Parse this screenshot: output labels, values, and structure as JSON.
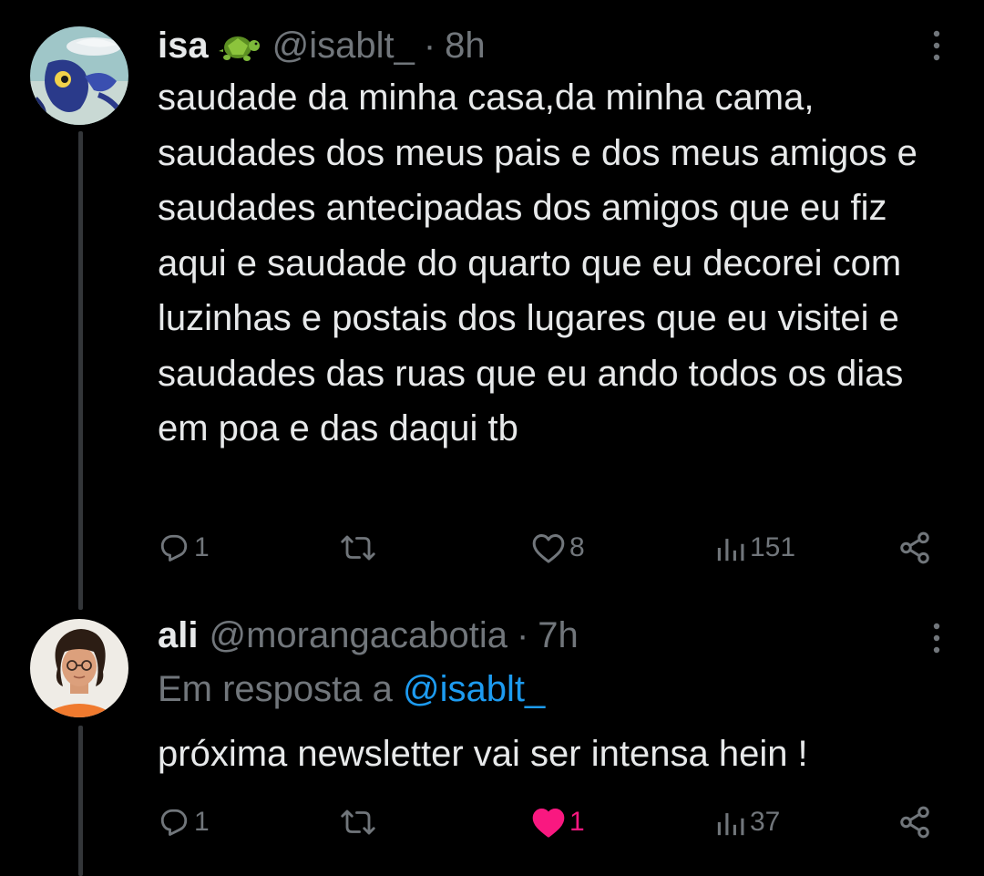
{
  "tweets": [
    {
      "name": "isa",
      "emoji": "turtle-emoji",
      "handle": "@isablt_",
      "separator": "·",
      "time": "8h",
      "text": "saudade da minha casa,da minha cama, saudades dos meus pais e dos meus amigos e saudades antecipadas dos amigos que eu fiz aqui e saudade do quarto que eu decorei com luzinhas e postais dos lugares que eu visitei e saudades das ruas que eu ando todos os dias em poa e das daqui tb",
      "actions": {
        "replies": "1",
        "retweets": "",
        "likes": "8",
        "views": "151"
      },
      "liked": false
    },
    {
      "name": "ali",
      "handle": "@morangacabotia",
      "separator": "·",
      "time": "7h",
      "reply_prefix": "Em resposta a",
      "reply_mention": "@isablt_",
      "text": "próxima newsletter vai ser intensa hein !",
      "actions": {
        "replies": "1",
        "retweets": "",
        "likes": "1",
        "views": "37"
      },
      "liked": true
    }
  ],
  "colors": {
    "background": "#000000",
    "text": "#e7e9ea",
    "muted": "#71767b",
    "mention": "#1d9bf0",
    "like_active": "#f91880",
    "thread_line": "#333639"
  }
}
